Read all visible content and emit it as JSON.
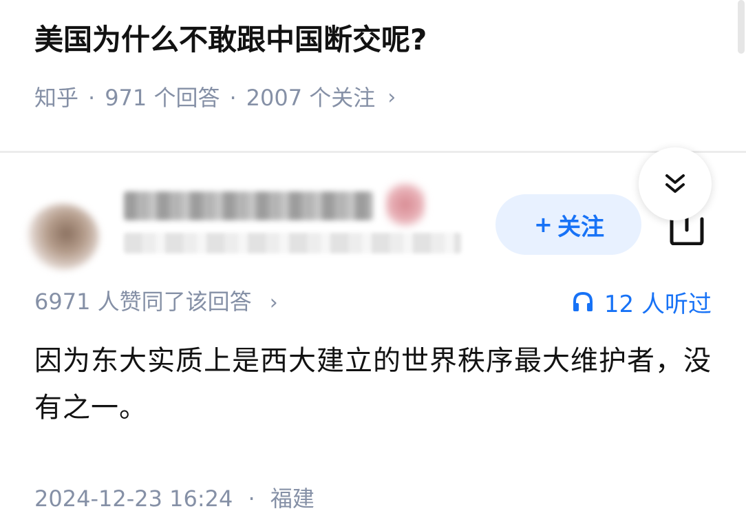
{
  "question": {
    "title": "美国为什么不敢跟中国断交呢?",
    "source": "知乎",
    "answers_count": "971 个回答",
    "followers_count": "2007 个关注",
    "separator": "·",
    "chevron": "›"
  },
  "author": {
    "follow_label": "关注",
    "follow_plus": "+"
  },
  "answer": {
    "vote_text": "6971 人赞同了该回答",
    "vote_chevron": "›",
    "listen_text": "12 人听过",
    "content": "因为东大实质上是西大建立的世界秩序最大维护者，没有之一。",
    "time": "2024-12-23 16:24",
    "separator": "·",
    "location": "福建"
  },
  "colors": {
    "accent": "#1772f6",
    "muted": "#8590a6",
    "text": "#121212",
    "follow_bg": "#e8f1ff"
  },
  "icons": {
    "collapse": "double-chevron-down-icon",
    "share": "share-icon",
    "listen": "headphones-icon",
    "follow": "plus-icon"
  }
}
